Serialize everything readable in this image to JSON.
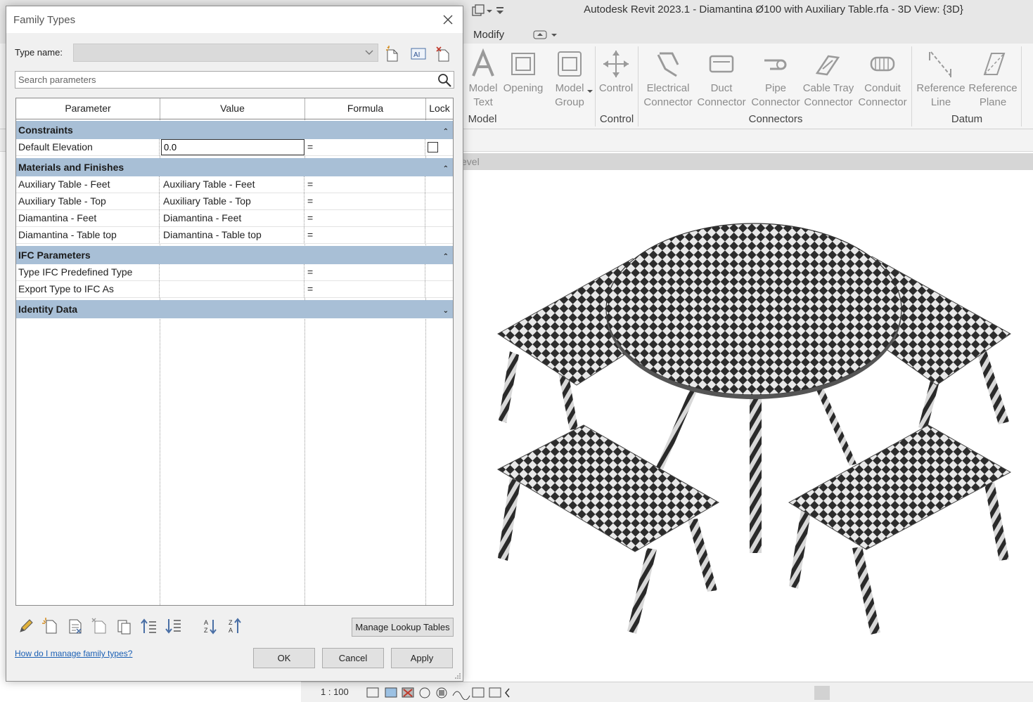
{
  "app": {
    "title": "Autodesk Revit 2023.1 - Diamantina Ø100 with Auxiliary Table.rfa - 3D View: {3D}",
    "tabs": [
      "Modify"
    ],
    "ribbon_groups": [
      {
        "label": "Model",
        "tools": [
          "Model Text",
          "Opening",
          "Model Group"
        ]
      },
      {
        "label": "Control",
        "tools": [
          "Control"
        ]
      },
      {
        "label": "Connectors",
        "tools": [
          "Electrical Connector",
          "Duct Connector",
          "Pipe Connector",
          "Cable Tray Connector",
          "Conduit Connector"
        ]
      },
      {
        "label": "Datum",
        "tools": [
          "Reference Line",
          "Reference Plane"
        ]
      }
    ],
    "view_header_fragment": "evel",
    "view_scale": "1 : 100"
  },
  "dialog": {
    "title": "Family Types",
    "type_name_label": "Type name:",
    "search_placeholder": "Search parameters",
    "columns": {
      "parameter": "Parameter",
      "value": "Value",
      "formula": "Formula",
      "lock": "Lock"
    },
    "groups": [
      {
        "name": "Constraints",
        "collapsed": false,
        "rows": [
          {
            "parameter": "Default Elevation",
            "value": "0.0",
            "formula": "=",
            "lock": false
          }
        ]
      },
      {
        "name": "Materials and Finishes",
        "collapsed": false,
        "rows": [
          {
            "parameter": "Auxiliary Table - Feet",
            "value": "Auxiliary Table - Feet",
            "formula": "="
          },
          {
            "parameter": "Auxiliary Table - Top",
            "value": "Auxiliary Table - Top",
            "formula": "="
          },
          {
            "parameter": "Diamantina - Feet",
            "value": "Diamantina - Feet",
            "formula": "="
          },
          {
            "parameter": "Diamantina - Table top",
            "value": "Diamantina - Table top",
            "formula": "="
          }
        ]
      },
      {
        "name": "IFC Parameters",
        "collapsed": false,
        "rows": [
          {
            "parameter": "Type IFC Predefined Type",
            "value": "",
            "formula": "="
          },
          {
            "parameter": "Export Type to IFC As",
            "value": "",
            "formula": "="
          }
        ]
      },
      {
        "name": "Identity Data",
        "collapsed": true,
        "rows": []
      }
    ],
    "manage_lookup_label": "Manage Lookup Tables",
    "help_link": "How do I manage family types?",
    "ok_label": "OK",
    "cancel_label": "Cancel",
    "apply_label": "Apply"
  }
}
